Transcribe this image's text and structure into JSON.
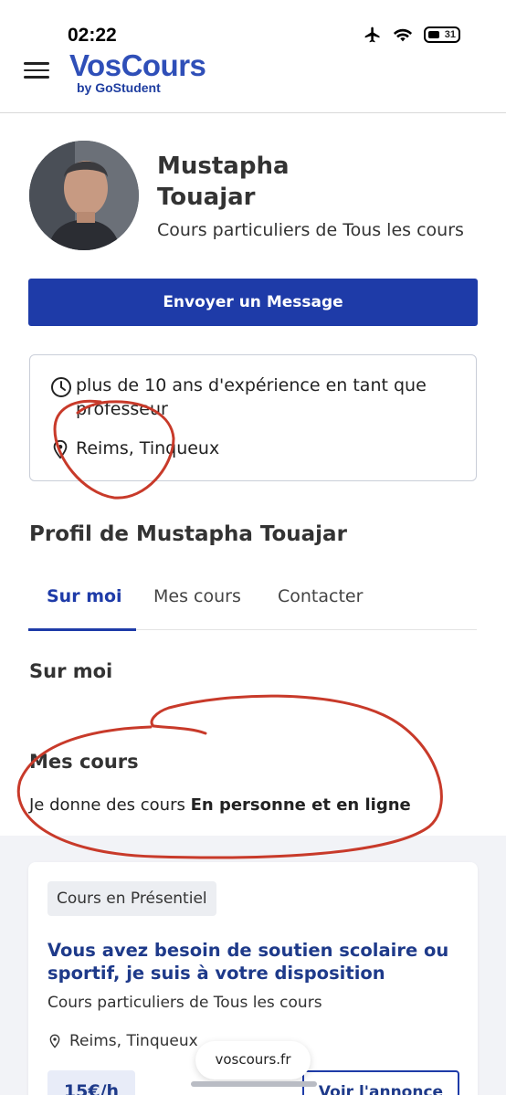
{
  "status_bar": {
    "time": "02:22",
    "battery_level": "31"
  },
  "header": {
    "logo_main": "VosCours",
    "logo_sub": "by GoStudent"
  },
  "profile": {
    "name": "Mustapha\nTouajar",
    "subtitle": "Cours particuliers de Tous les cours",
    "message_button": "Envoyer un Message"
  },
  "info": {
    "experience": "plus de 10 ans d'expérience en tant que professeur",
    "location": "Reims, Tinqueux"
  },
  "profile_section": {
    "title": "Profil de Mustapha Touajar",
    "tabs": [
      {
        "label": "Sur moi"
      },
      {
        "label": "Mes cours"
      },
      {
        "label": "Contacter"
      }
    ]
  },
  "sur_moi": {
    "title": "Sur moi"
  },
  "mes_cours": {
    "title": "Mes cours",
    "text_prefix": "Je donne des cours ",
    "text_bold": "En personne et en ligne"
  },
  "course_card": {
    "badge": "Cours en Présentiel",
    "title": "Vous avez besoin de soutien scolaire ou sportif, je suis à votre disposition",
    "subtitle": "Cours particuliers de Tous les cours",
    "location": "Reims, Tinqueux",
    "price": "15€/h",
    "view_button": "Voir l'annonce"
  },
  "browser": {
    "url": "voscours.fr"
  }
}
